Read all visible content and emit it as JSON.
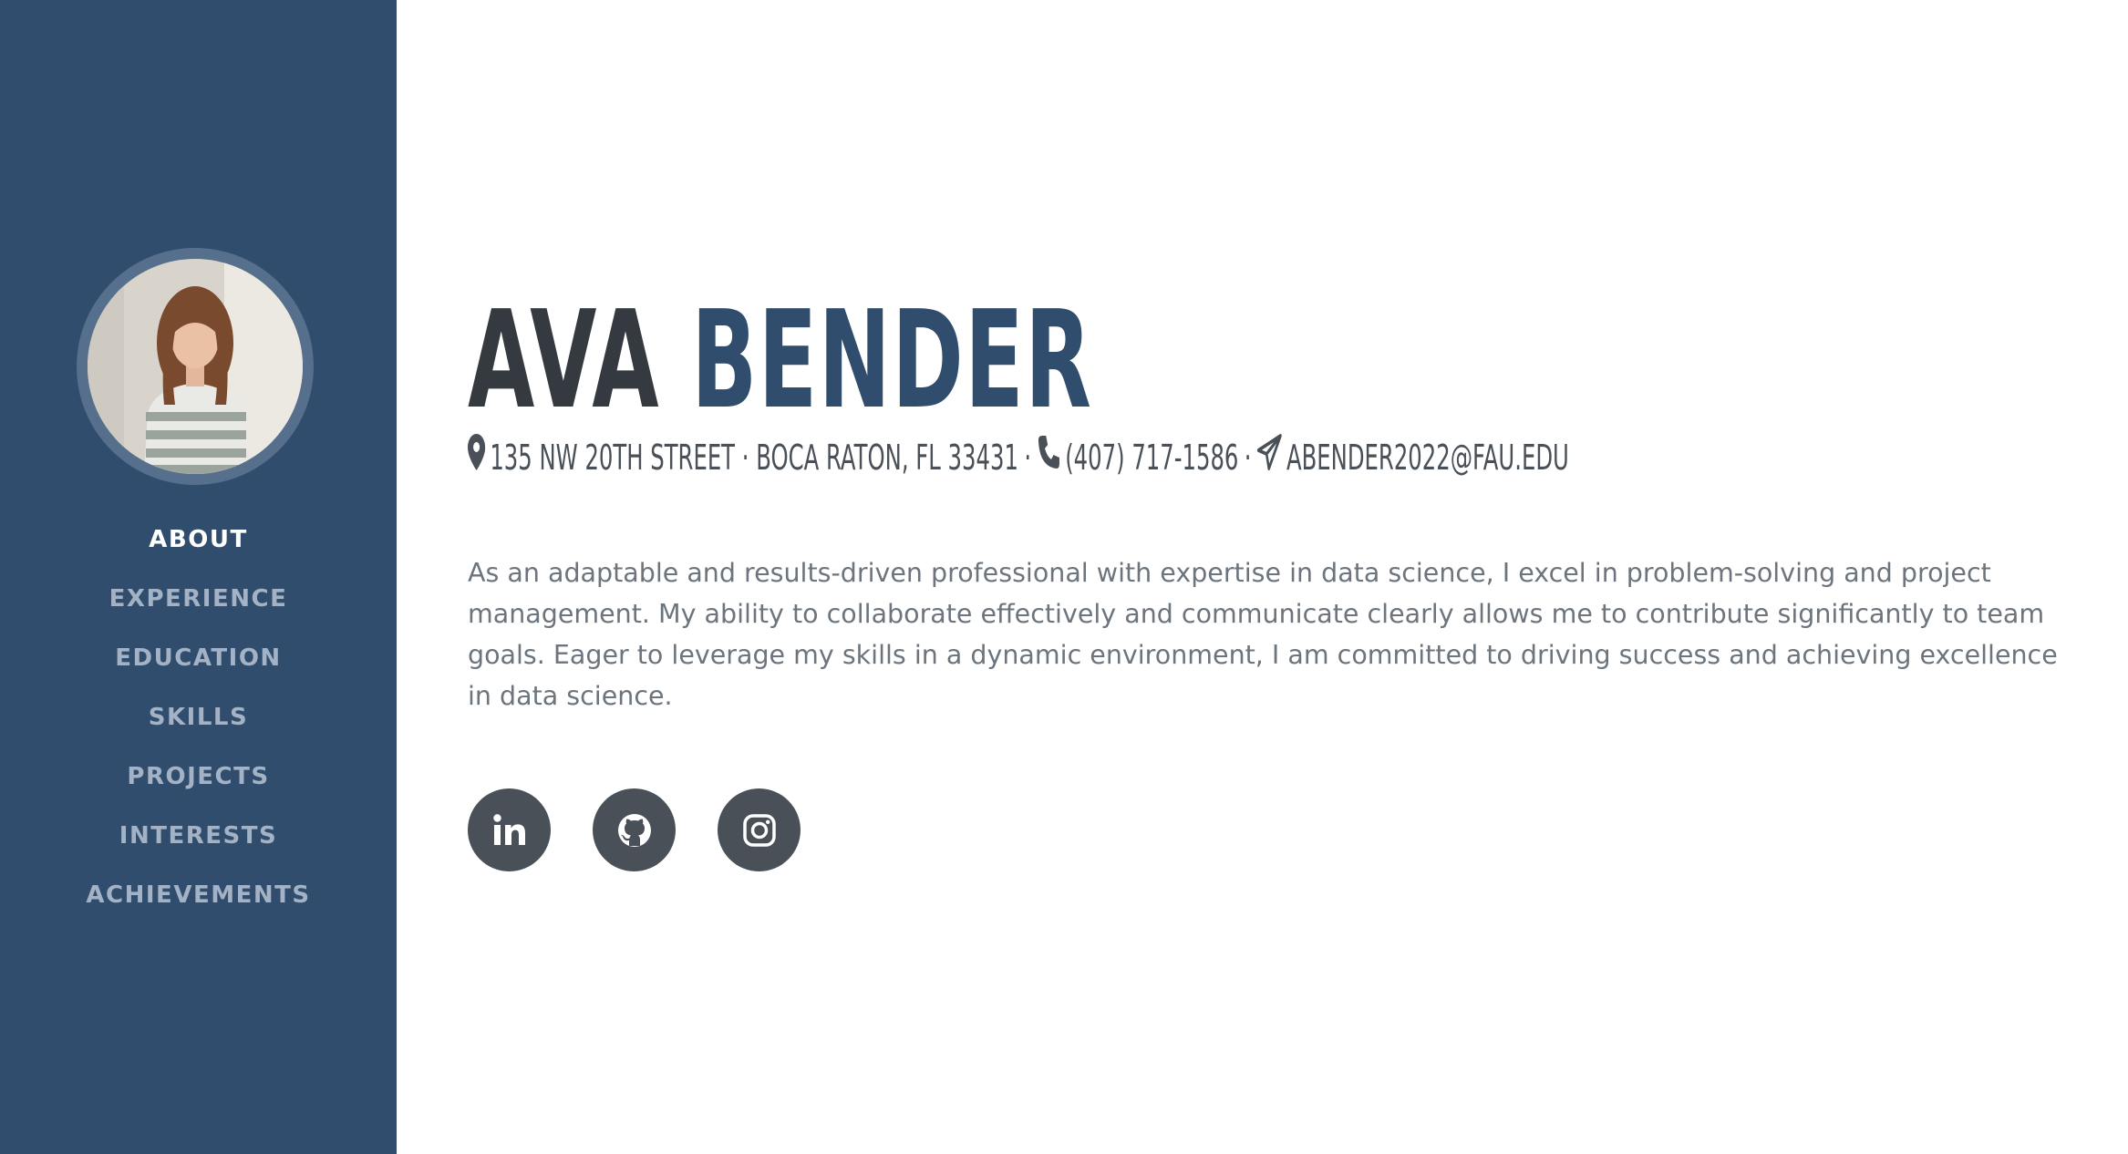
{
  "profile": {
    "first_name": "AVA",
    "last_name": "BENDER",
    "photo_alt": "profile photo"
  },
  "contact": {
    "address": "135 NW 20TH STREET · BOCA RATON, FL 33431",
    "phone": "(407) 717-1586",
    "email": "ABENDER2022@FAU.EDU",
    "separator": "·",
    "icons": [
      "map-marker-icon",
      "phone-icon",
      "paper-plane-icon"
    ]
  },
  "nav": {
    "active": "ABOUT",
    "items": [
      {
        "label": "ABOUT"
      },
      {
        "label": "EXPERIENCE"
      },
      {
        "label": "EDUCATION"
      },
      {
        "label": "SKILLS"
      },
      {
        "label": "PROJECTS"
      },
      {
        "label": "INTERESTS"
      },
      {
        "label": "ACHIEVEMENTS"
      }
    ]
  },
  "about": {
    "text": "As an adaptable and results-driven professional with expertise in data science, I excel in problem-solving and project management. My ability to collaborate effectively and communicate clearly allows me to contribute significantly to team goals. Eager to leverage my skills in a dynamic environment, I am committed to driving success and achieving excellence in data science."
  },
  "socials": [
    {
      "icon": "linkedin-icon"
    },
    {
      "icon": "github-icon"
    },
    {
      "icon": "instagram-icon"
    }
  ],
  "colors": {
    "sidebar": "#314d6d",
    "accent": "#314d6d",
    "name_first": "#343a40",
    "nav_inactive": "#a3b2c5",
    "nav_active": "#ffffff",
    "social_bg": "#495057",
    "body_text": "#6c757d"
  }
}
